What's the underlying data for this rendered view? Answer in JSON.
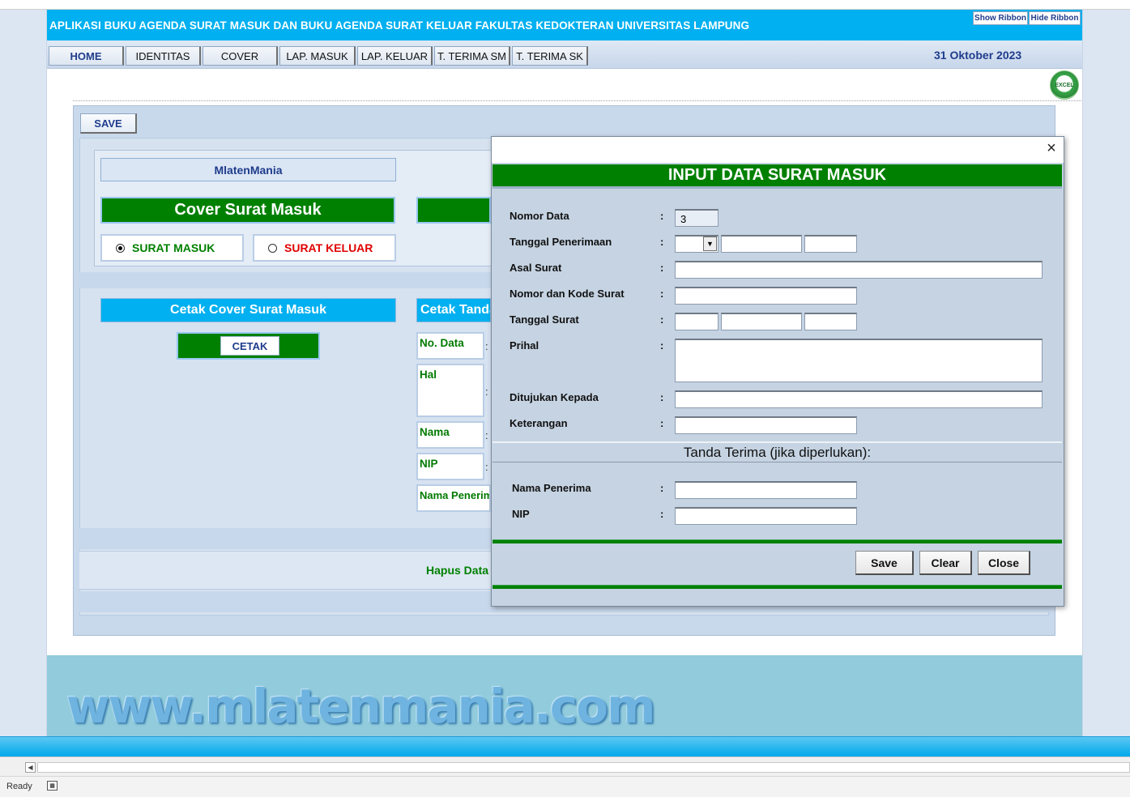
{
  "app": {
    "title": "APLIKASI BUKU AGENDA SURAT MASUK DAN BUKU AGENDA SURAT KELUAR  FAKULTAS KEDOKTERAN UNIVERSITAS LAMPUNG",
    "show_ribbon": "Show Ribbon",
    "hide_ribbon": "Hide Ribbon",
    "date": "31 Oktober 2023",
    "logo_text": "EXCEL"
  },
  "menu": {
    "tabs": [
      "HOME",
      "IDENTITAS",
      "COVER",
      "LAP. MASUK",
      "LAP. KELUAR",
      "T. TERIMA SM",
      "T. TERIMA SK"
    ]
  },
  "page": {
    "save": "SAVE",
    "owner": "MlatenMania",
    "cover_title": "Cover Surat Masuk",
    "radio_masuk": "SURAT MASUK",
    "radio_keluar": "SURAT KELUAR",
    "cetak_cover": "Cetak Cover Surat Masuk",
    "cetak_tanda": "Cetak Tanda",
    "cetak_btn": "CETAK",
    "fields": [
      "No. Data",
      "Hal",
      "Nama",
      "NIP",
      "Nama Penerima"
    ],
    "hapus": "Hapus Data",
    "watermark": "www.mlatenmania.com"
  },
  "dialog": {
    "close": "×",
    "title": "INPUT DATA SURAT MASUK",
    "labels": {
      "nomor_data": "Nomor Data",
      "tgl_penerimaan": "Tanggal Penerimaan",
      "asal_surat": "Asal Surat",
      "nomor_kode": "Nomor dan Kode Surat",
      "tgl_surat": "Tanggal Surat",
      "prihal": "Prihal",
      "ditujukan": "Ditujukan Kepada",
      "keterangan": "Keterangan",
      "nama_penerima": "Nama Penerima",
      "nip": "NIP"
    },
    "colon": ":",
    "values": {
      "nomor_data": "3"
    },
    "tanda_terima": "Tanda Terima (jika diperlukan):",
    "buttons": {
      "save": "Save",
      "clear": "Clear",
      "close": "Close"
    }
  },
  "status": {
    "ready": "Ready"
  }
}
